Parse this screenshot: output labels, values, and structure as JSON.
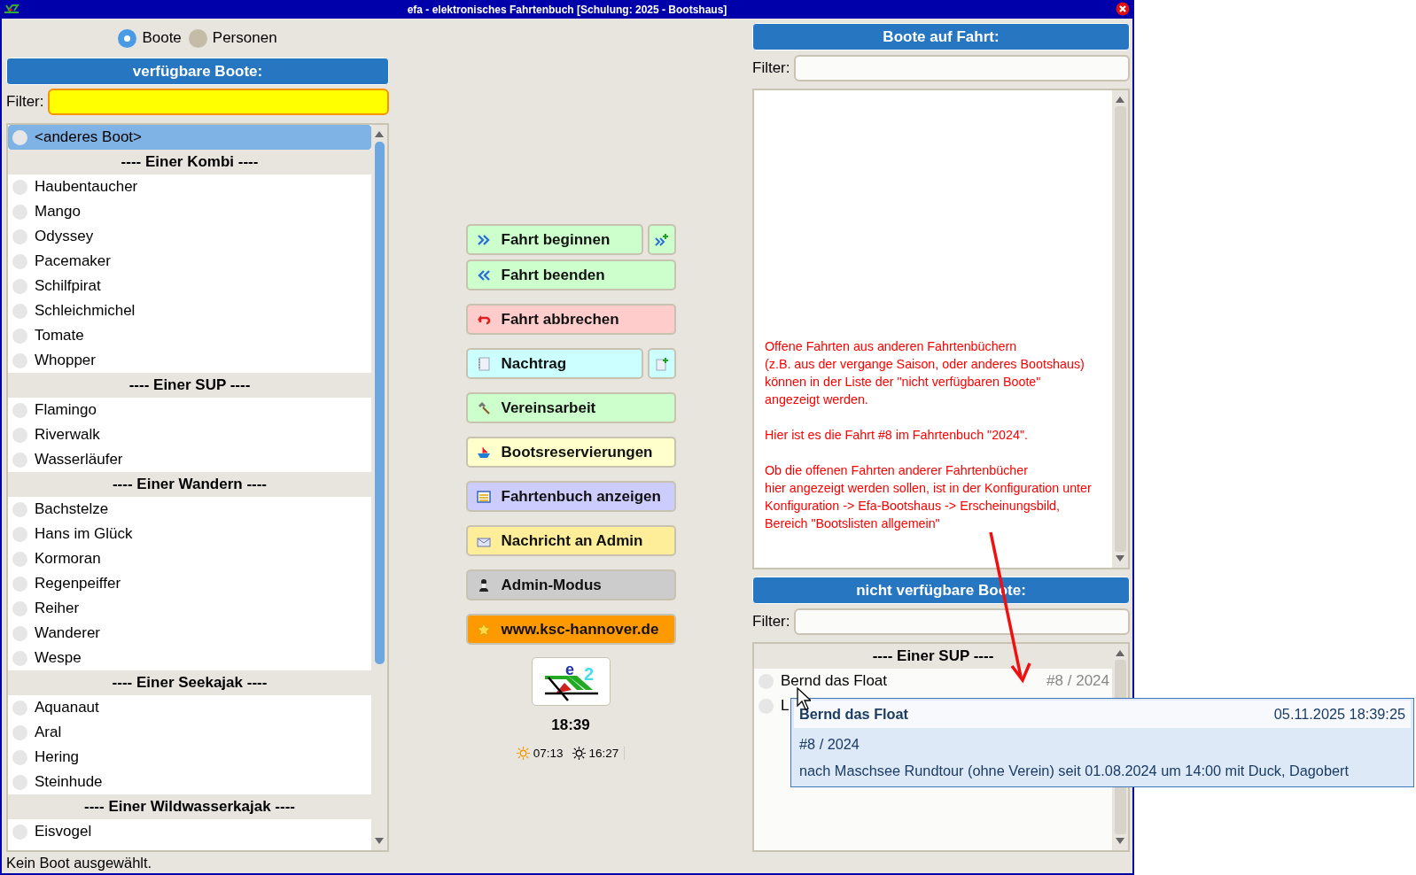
{
  "window": {
    "title": "efa - elektronisches Fahrtenbuch [Schulung: 2025 - Bootshaus]"
  },
  "list_mode": [
    {
      "label": "Boote",
      "selected": true
    },
    {
      "label": "Personen",
      "selected": false
    }
  ],
  "available_boats": {
    "title": "verfügbare Boote:",
    "filter": {
      "label": "Filter:",
      "focused": true
    },
    "items": [
      {
        "kind": "item",
        "label": "<anderes Boot>",
        "selected": true
      },
      {
        "kind": "header",
        "label": "---- Einer Kombi ----"
      },
      {
        "kind": "item",
        "label": "Haubentaucher",
        "selected": false
      },
      {
        "kind": "item",
        "label": "Mango",
        "selected": false
      },
      {
        "kind": "item",
        "label": "Odyssey",
        "selected": false
      },
      {
        "kind": "item",
        "label": "Pacemaker",
        "selected": false
      },
      {
        "kind": "item",
        "label": "Schilfpirat",
        "selected": false
      },
      {
        "kind": "item",
        "label": "Schleichmichel",
        "selected": false
      },
      {
        "kind": "item",
        "label": "Tomate",
        "selected": false
      },
      {
        "kind": "item",
        "label": "Whopper",
        "selected": false
      },
      {
        "kind": "header",
        "label": "---- Einer SUP ----"
      },
      {
        "kind": "item",
        "label": "Flamingo",
        "selected": false
      },
      {
        "kind": "item",
        "label": "Riverwalk",
        "selected": false
      },
      {
        "kind": "item",
        "label": "Wasserläufer",
        "selected": false
      },
      {
        "kind": "header",
        "label": "---- Einer Wandern ----"
      },
      {
        "kind": "item",
        "label": "Bachstelze",
        "selected": false
      },
      {
        "kind": "item",
        "label": "Hans im Glück",
        "selected": false
      },
      {
        "kind": "item",
        "label": "Kormoran",
        "selected": false
      },
      {
        "kind": "item",
        "label": "Regenpeiffer",
        "selected": false
      },
      {
        "kind": "item",
        "label": "Reiher",
        "selected": false
      },
      {
        "kind": "item",
        "label": "Wanderer",
        "selected": false
      },
      {
        "kind": "item",
        "label": "Wespe",
        "selected": false
      },
      {
        "kind": "header",
        "label": "---- Einer Seekajak ----"
      },
      {
        "kind": "item",
        "label": "Aquanaut",
        "selected": false
      },
      {
        "kind": "item",
        "label": "Aral",
        "selected": false
      },
      {
        "kind": "item",
        "label": "Hering",
        "selected": false
      },
      {
        "kind": "item",
        "label": "Steinhude",
        "selected": false
      },
      {
        "kind": "header",
        "label": "---- Einer Wildwasserkajak ----"
      },
      {
        "kind": "item",
        "label": "Eisvogel",
        "selected": false
      }
    ]
  },
  "actions": [
    {
      "label": "Fahrt beginnen",
      "color": "#ccffcc",
      "side_button": true
    },
    {
      "label": "Fahrt beenden",
      "color": "#ccffcc",
      "side_button": false
    },
    {
      "label": "Fahrt abbrechen",
      "color": "#ffcccc",
      "side_button": false
    },
    {
      "label": "Nachtrag",
      "color": "#ccffff",
      "side_button": true
    },
    {
      "label": "Vereinsarbeit",
      "color": "#ccffcc",
      "side_button": false
    },
    {
      "label": "Bootsreservierungen",
      "color": "#ffffcc",
      "side_button": false
    },
    {
      "label": "Fahrtenbuch anzeigen",
      "color": "#ccccff",
      "side_button": false
    },
    {
      "label": "Nachricht an Admin",
      "color": "#ffee99",
      "side_button": false
    },
    {
      "label": "Admin-Modus",
      "color": "#cccccc",
      "side_button": false
    },
    {
      "label": "www.ksc-hannover.de",
      "color": "#ff9900",
      "side_button": false
    }
  ],
  "logo": {
    "letter": "e",
    "number": "2"
  },
  "clock": "18:39",
  "sunrise": "07:13",
  "sunset": "16:27",
  "boats_on_trip": {
    "title": "Boote auf Fahrt:",
    "filter": {
      "label": "Filter:",
      "focused": false
    },
    "note": [
      "Offene Fahrten aus anderen Fahrtenbüchern\n(z.B. aus der vergange Saison, oder anderes Bootshaus)\nkönnen in der Liste der \"nicht verfügbaren Boote\"\nangezeigt werden.",
      "Hier ist es die Fahrt #8 im Fahrtenbuch \"2024\".",
      "Ob die offenen Fahrten anderer Fahrtenbücher\nhier angezeigt werden sollen, ist in der Konfiguration unter\nKonfiguration -> Efa-Bootshaus -> Erscheinungsbild,\nBereich \"Bootslisten allgemein\""
    ]
  },
  "unavailable_boats": {
    "title": "nicht verfügbare Boote:",
    "filter": {
      "label": "Filter:",
      "focused": false
    },
    "items": [
      {
        "kind": "header",
        "label": "---- Einer SUP ----"
      },
      {
        "kind": "item",
        "label": "Bernd das Float",
        "detail": "#8 / 2024",
        "selected": false
      },
      {
        "kind": "item",
        "label": "L",
        "selected": false
      }
    ]
  },
  "tooltip": {
    "title": "Bernd das Float",
    "timestamp": "05.11.2025 18:39:25",
    "lines": [
      "#8 / 2024",
      "nach Maschsee Rundtour (ohne Verein) seit 01.08.2024 um 14:00 mit Duck, Dagobert"
    ]
  },
  "status_bar": "Kein Boot ausgewählt."
}
